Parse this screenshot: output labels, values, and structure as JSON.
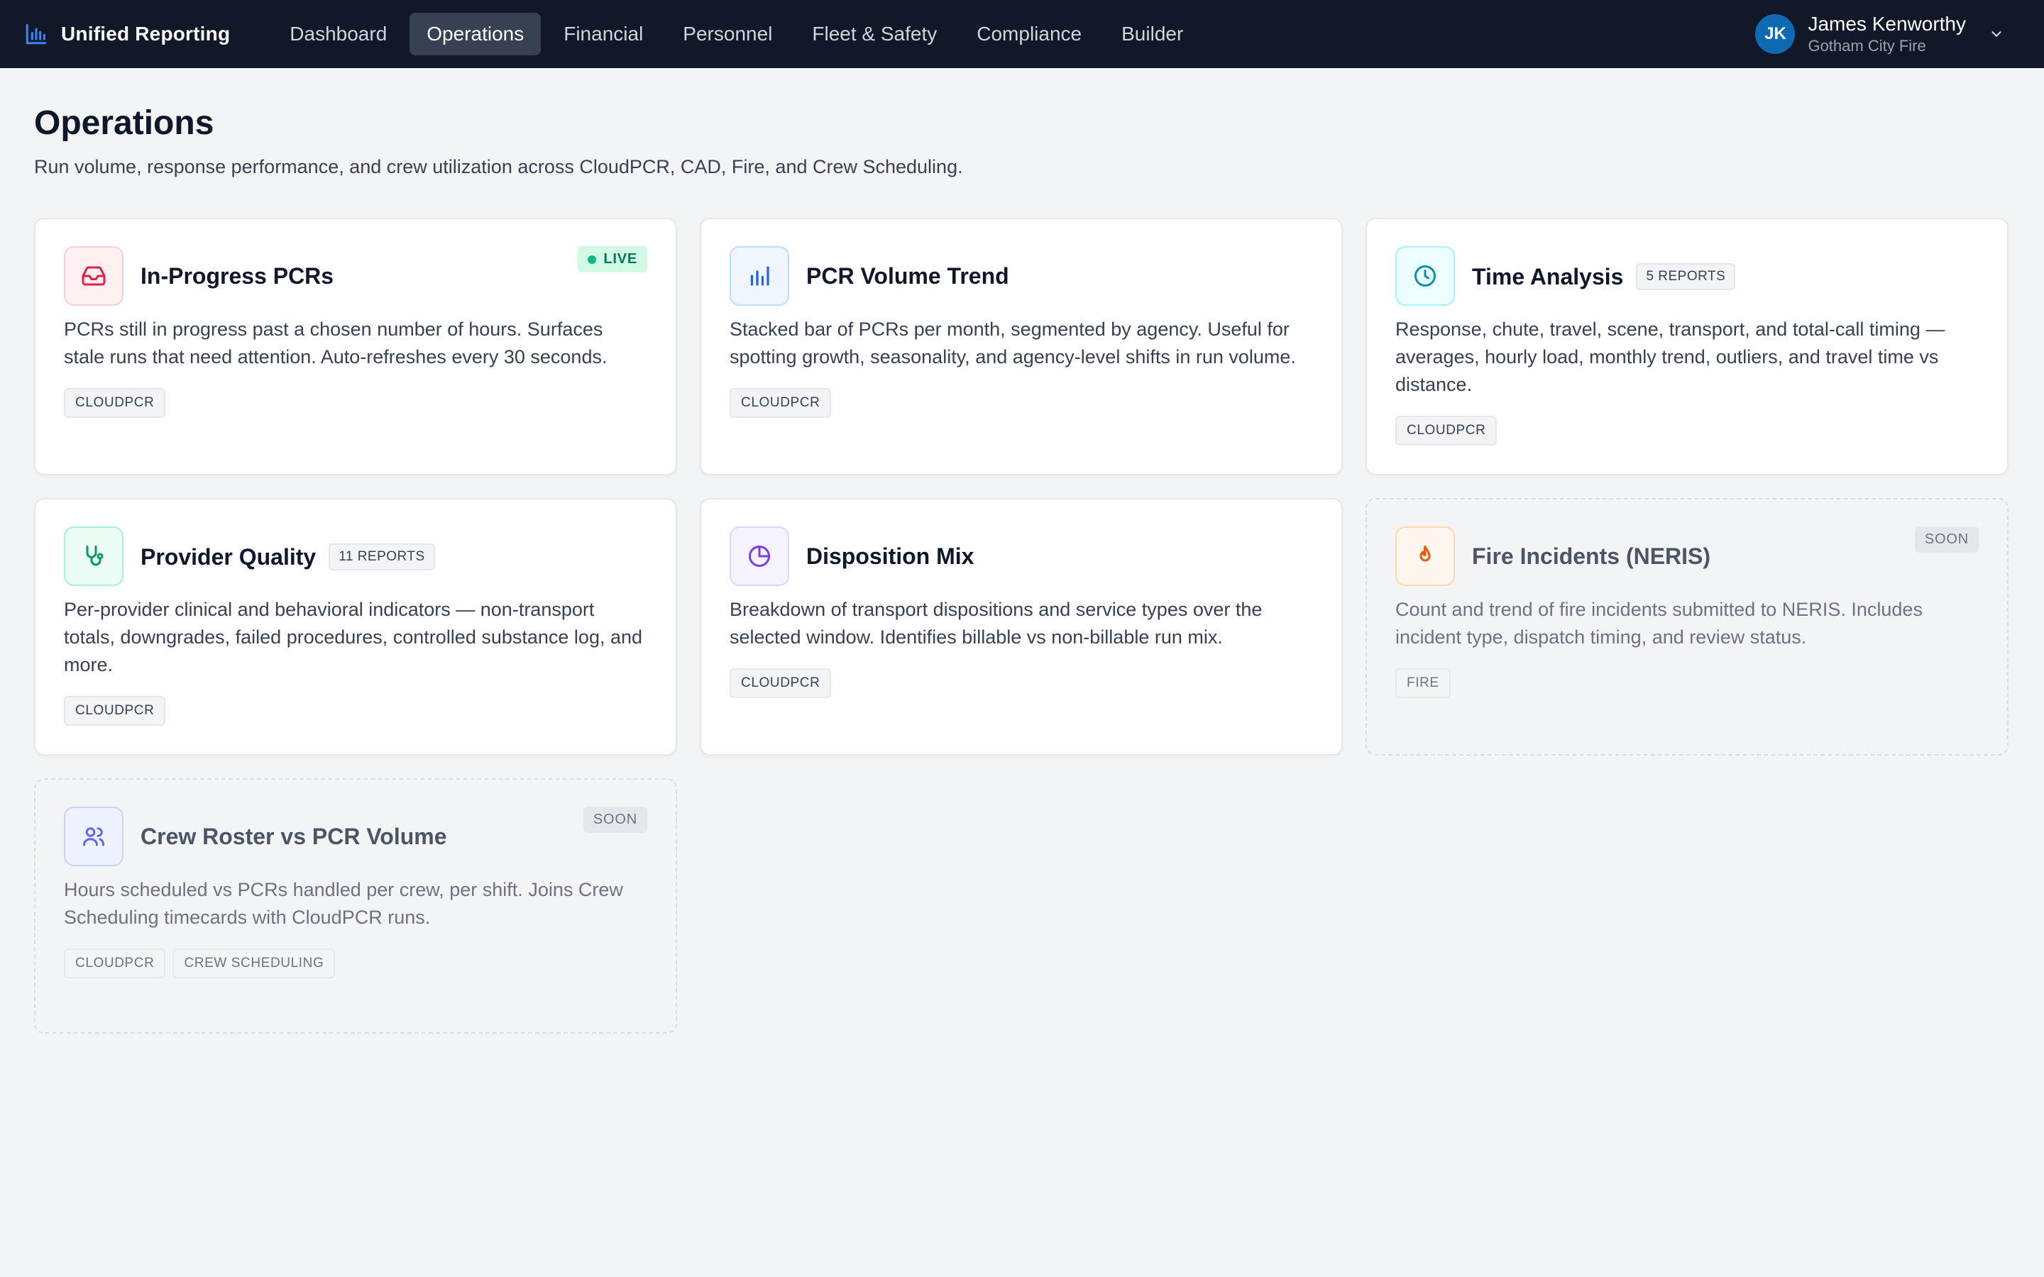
{
  "app": {
    "name": "Unified Reporting"
  },
  "nav": {
    "items": [
      {
        "label": "Dashboard"
      },
      {
        "label": "Operations"
      },
      {
        "label": "Financial"
      },
      {
        "label": "Personnel"
      },
      {
        "label": "Fleet & Safety"
      },
      {
        "label": "Compliance"
      },
      {
        "label": "Builder"
      }
    ],
    "active": "Operations"
  },
  "user": {
    "initials": "JK",
    "name": "James Kenworthy",
    "org": "Gotham City Fire"
  },
  "page": {
    "title": "Operations",
    "subtitle": "Run volume, response performance, and crew utilization across CloudPCR, CAD, Fire, and Crew Scheduling."
  },
  "cards": [
    {
      "title": "In-Progress PCRs",
      "badge": "LIVE",
      "description": "PCRs still in progress past a chosen number of hours. Surfaces stale runs that need attention. Auto-refreshes every 30 seconds.",
      "tags": [
        "CLOUDPCR"
      ],
      "icon": "inbox-icon",
      "color": "#e11d48"
    },
    {
      "title": "PCR Volume Trend",
      "description": "Stacked bar of PCRs per month, segmented by agency. Useful for spotting growth, seasonality, and agency-level shifts in run volume.",
      "tags": [
        "CLOUDPCR"
      ],
      "icon": "bar-chart-icon",
      "color": "#2563eb"
    },
    {
      "title": "Time Analysis",
      "count": "5 REPORTS",
      "description": "Response, chute, travel, scene, transport, and total-call timing — averages, hourly load, monthly trend, outliers, and travel time vs distance.",
      "tags": [
        "CLOUDPCR"
      ],
      "icon": "clock-icon",
      "color": "#0891b2"
    },
    {
      "title": "Provider Quality",
      "count": "11 REPORTS",
      "description": "Per-provider clinical and behavioral indicators — non-transport totals, downgrades, failed procedures, controlled substance log, and more.",
      "tags": [
        "CLOUDPCR"
      ],
      "icon": "stethoscope-icon",
      "color": "#059669"
    },
    {
      "title": "Disposition Mix",
      "description": "Breakdown of transport dispositions and service types over the selected window. Identifies billable vs non-billable run mix.",
      "tags": [
        "CLOUDPCR"
      ],
      "icon": "pie-chart-icon",
      "color": "#7c3aed"
    },
    {
      "title": "Fire Incidents (NERIS)",
      "badge": "SOON",
      "description": "Count and trend of fire incidents submitted to NERIS. Includes incident type, dispatch timing, and review status.",
      "tags": [
        "FIRE"
      ],
      "icon": "flame-icon",
      "color": "#ea580c"
    },
    {
      "title": "Crew Roster vs PCR Volume",
      "badge": "SOON",
      "description": "Hours scheduled vs PCRs handled per crew, per shift. Joins Crew Scheduling timecards with CloudPCR runs.",
      "tags": [
        "CLOUDPCR",
        "CREW SCHEDULING"
      ],
      "icon": "users-icon",
      "color": "#6366f1"
    }
  ]
}
